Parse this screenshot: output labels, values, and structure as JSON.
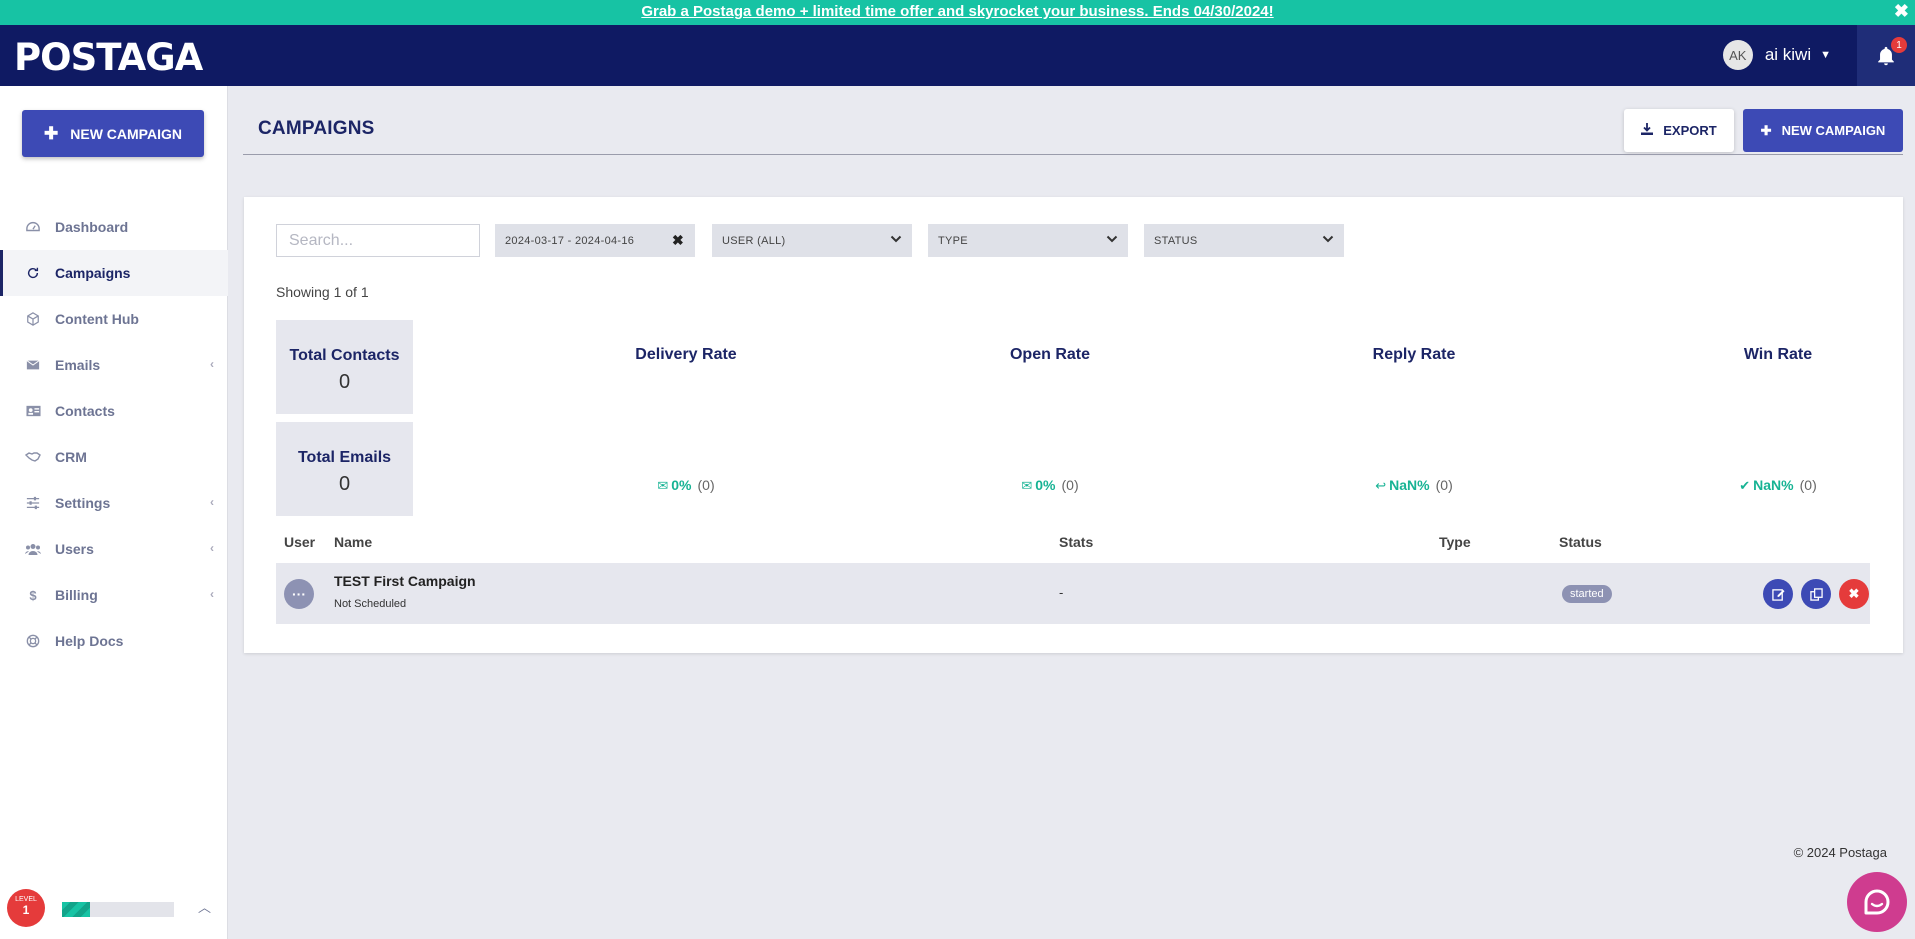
{
  "promo": {
    "text": "Grab a Postaga demo + limited time offer and skyrocket your business. Ends 04/30/2024!",
    "close": "✖"
  },
  "header": {
    "logo": "POSTAGA",
    "user_initials": "AK",
    "user_name": "ai kiwi",
    "notification_count": "1"
  },
  "sidebar": {
    "new_campaign_label": "NEW CAMPAIGN",
    "items": [
      {
        "label": "Dashboard",
        "icon": "dashboard-icon",
        "active": false,
        "chevron": false
      },
      {
        "label": "Campaigns",
        "icon": "refresh-icon",
        "active": true,
        "chevron": false
      },
      {
        "label": "Content Hub",
        "icon": "cube-icon",
        "active": false,
        "chevron": false
      },
      {
        "label": "Emails",
        "icon": "envelope-icon",
        "active": false,
        "chevron": true
      },
      {
        "label": "Contacts",
        "icon": "id-card-icon",
        "active": false,
        "chevron": false
      },
      {
        "label": "CRM",
        "icon": "handshake-icon",
        "active": false,
        "chevron": false
      },
      {
        "label": "Settings",
        "icon": "sliders-icon",
        "active": false,
        "chevron": true
      },
      {
        "label": "Users",
        "icon": "users-icon",
        "active": false,
        "chevron": true
      },
      {
        "label": "Billing",
        "icon": "dollar-icon",
        "active": false,
        "chevron": true
      },
      {
        "label": "Help Docs",
        "icon": "lifebuoy-icon",
        "active": false,
        "chevron": false
      }
    ],
    "level_word": "LEVEL",
    "level_number": "1",
    "level_progress": 0.25
  },
  "page": {
    "title": "CAMPAIGNS",
    "export_label": "EXPORT",
    "new_campaign_label": "NEW CAMPAIGN"
  },
  "filters": {
    "search_placeholder": "Search...",
    "date_range": "2024-03-17 - 2024-04-16",
    "user": "USER (ALL)",
    "type": "TYPE",
    "status": "STATUS"
  },
  "showing": "Showing 1 of 1",
  "stats": {
    "total_contacts_label": "Total Contacts",
    "total_contacts_value": "0",
    "total_emails_label": "Total Emails",
    "total_emails_value": "0",
    "rates": [
      {
        "label": "Delivery Rate",
        "value": "0%",
        "count": "(0)",
        "icon": "envelope-icon"
      },
      {
        "label": "Open Rate",
        "value": "0%",
        "count": "(0)",
        "icon": "envelope-open-icon"
      },
      {
        "label": "Reply Rate",
        "value": "NaN%",
        "count": "(0)",
        "icon": "reply-icon"
      },
      {
        "label": "Win Rate",
        "value": "NaN%",
        "count": "(0)",
        "icon": "check-icon"
      }
    ]
  },
  "table": {
    "headers": {
      "user": "User",
      "name": "Name",
      "stats": "Stats",
      "type": "Type",
      "status": "Status"
    },
    "rows": [
      {
        "avatar": "···",
        "name": "TEST First Campaign",
        "schedule": "Not Scheduled",
        "stats": "-",
        "type": "",
        "status": "started"
      }
    ]
  },
  "footer": {
    "copyright": "© 2024 Postaga"
  },
  "colors": {
    "promo": "#17c3a4",
    "nav": "#0f1a63",
    "primary": "#3d4ab5",
    "accent_green": "#17b394",
    "danger": "#e53b3b",
    "chat": "#cf3c8f"
  }
}
